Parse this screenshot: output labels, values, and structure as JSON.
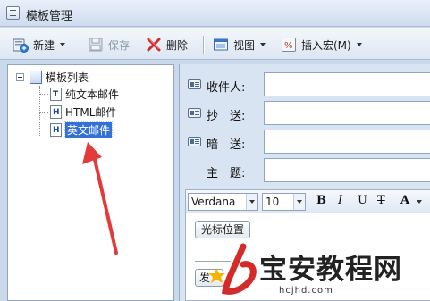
{
  "window": {
    "title": "模板管理"
  },
  "toolbar": {
    "new_label": "新建",
    "save_label": "保存",
    "delete_label": "删除",
    "view_label": "视图",
    "insert_macro_label": "插入宏(M)"
  },
  "tree": {
    "root_label": "模板列表",
    "items": [
      {
        "label": "纯文本邮件",
        "icon": "text-doc-icon"
      },
      {
        "label": "HTML邮件",
        "icon": "html-doc-icon"
      },
      {
        "label": "英文邮件",
        "icon": "html-doc-icon",
        "selected": true
      }
    ]
  },
  "fields": {
    "to_label": "收件人:",
    "cc_label": "抄　送:",
    "bcc_label": "暗　送:",
    "subject_label": "主　题:"
  },
  "format_bar": {
    "font_family": "Verdana",
    "font_size": "10",
    "bold": "B",
    "italic": "I",
    "underline": "U",
    "strike": "T",
    "font_color": "A"
  },
  "editor": {
    "cursor_button_label": "光标位置",
    "partial_button_label": "发"
  },
  "watermark": {
    "text": "宝安教程网",
    "sub": "hcjhd.com"
  },
  "colors": {
    "arrow": "#e33b3b",
    "selection": "#3471d6",
    "watermark_red": "#d42a2a"
  }
}
